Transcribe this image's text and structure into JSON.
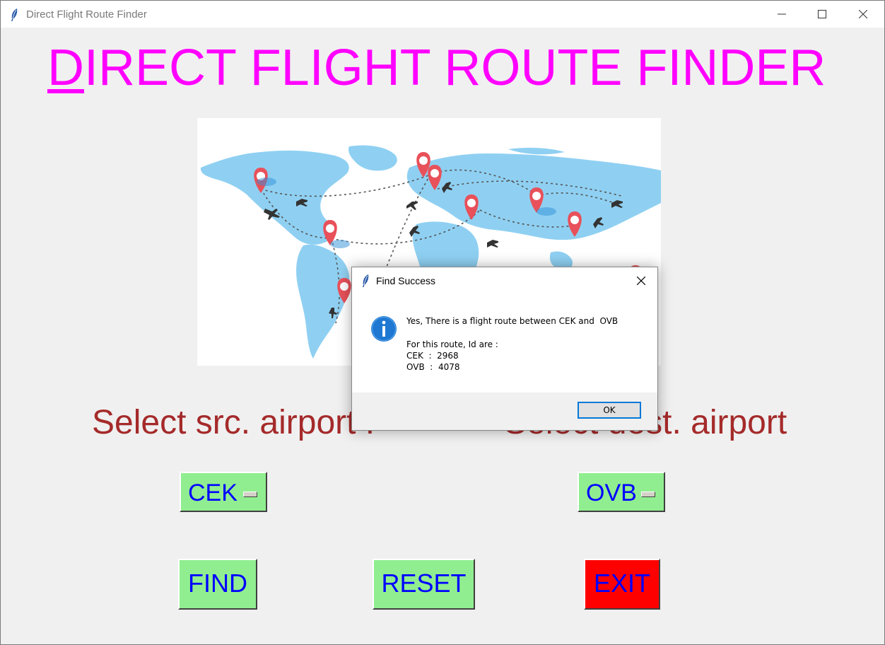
{
  "window": {
    "title": "Direct Flight Route Finder",
    "icons": {
      "app": "feather-icon",
      "minimize": "minimize-icon",
      "maximize": "maximize-icon",
      "close": "close-icon"
    }
  },
  "header": {
    "first_letter": "D",
    "rest": "IRECT FLIGHT ROUTE FINDER",
    "color": "#ff00ff"
  },
  "map": {
    "image": "world-map-flight-routes"
  },
  "labels": {
    "src": "Select src. airport :",
    "dest": "Select dest. airport",
    "color": "#a52a2a"
  },
  "src_select": {
    "value": "CEK"
  },
  "dest_select": {
    "value": "OVB"
  },
  "buttons": {
    "find": "FIND",
    "reset": "RESET",
    "exit": "EXIT"
  },
  "colors": {
    "button_bg": "#90ee90",
    "exit_bg": "#ff0000",
    "button_text": "#0000ff"
  },
  "dialog": {
    "title": "Find Success",
    "line1": "Yes, There is a flight route between CEK and  OVB",
    "line2": "For this route, Id are :",
    "line3": "CEK  :  2968",
    "line4": "OVB  :  4078",
    "ok": "OK",
    "icon": "info-icon"
  }
}
